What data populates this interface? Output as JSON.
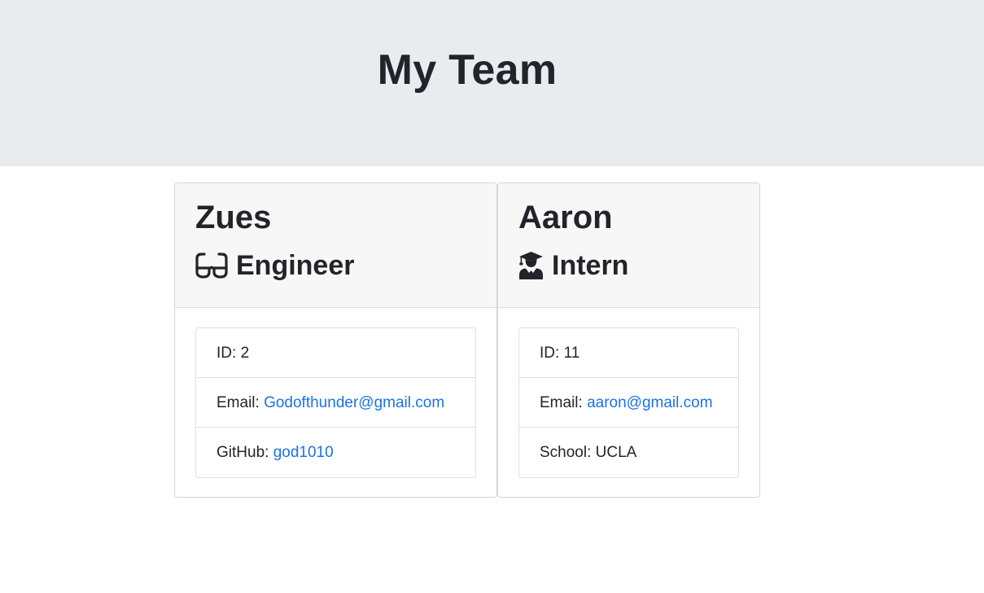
{
  "header": {
    "title": "My Team"
  },
  "employees": [
    {
      "name": "Zues",
      "role": "Engineer",
      "role_icon": "glasses-icon",
      "id_label": "ID:",
      "id": "2",
      "email_label": "Email:",
      "email": "Godofthunder@gmail.com",
      "extra_label": "GitHub:",
      "extra_value": "god1010",
      "extra_is_link": true
    },
    {
      "name": "Aaron",
      "role": "Intern",
      "role_icon": "user-graduate-icon",
      "id_label": "ID:",
      "id": "11",
      "email_label": "Email:",
      "email": "aaron@gmail.com",
      "extra_label": "School:",
      "extra_value": "UCLA",
      "extra_is_link": false
    }
  ],
  "colors": {
    "header_bg": "#e9ecef",
    "card_header_bg": "#f7f7f7",
    "link": "#1a73e8",
    "text": "#212529"
  }
}
